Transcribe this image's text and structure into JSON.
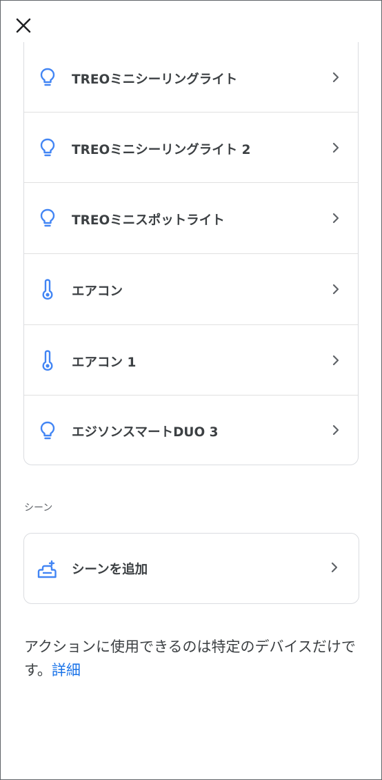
{
  "header": {
    "close_icon": "close-icon"
  },
  "devices": [
    {
      "label": "TREOミニシーリングライト",
      "icon": "lightbulb-icon"
    },
    {
      "label": "TREOミニシーリングライト 2",
      "icon": "lightbulb-icon"
    },
    {
      "label": "TREOミニスポットライト",
      "icon": "lightbulb-icon"
    },
    {
      "label": "エアコン",
      "icon": "thermometer-icon"
    },
    {
      "label": "エアコン 1",
      "icon": "thermometer-icon"
    },
    {
      "label": "エジソンスマートDUO 3",
      "icon": "lightbulb-icon"
    }
  ],
  "scenes": {
    "section_label": "シーン",
    "add_scene_label": "シーンを追加",
    "add_scene_icon": "scene-add-icon"
  },
  "footer": {
    "note": "アクションに使用できるのは特定のデバイスだけです。",
    "link": "詳細"
  },
  "colors": {
    "accent": "#1a73e8",
    "icon_blue": "#4285f4",
    "text": "#3c4043",
    "chevron": "#5f6368",
    "divider": "#e0e0e0"
  }
}
